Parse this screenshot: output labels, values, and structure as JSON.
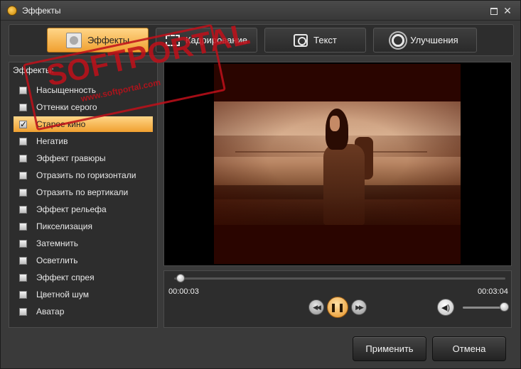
{
  "window": {
    "title": "Эффекты"
  },
  "tabs": [
    {
      "label": "Эффекты",
      "icon": "effects-icon",
      "active": true
    },
    {
      "label": "Кадрирование",
      "icon": "crop-icon",
      "active": false
    },
    {
      "label": "Текст",
      "icon": "text-icon",
      "active": false
    },
    {
      "label": "Улучшения",
      "icon": "enhance-icon",
      "active": false
    }
  ],
  "effects": {
    "label": "Эффекты:",
    "items": [
      {
        "label": "Насыщенность",
        "checked": false,
        "selected": false
      },
      {
        "label": "Оттенки серого",
        "checked": false,
        "selected": false
      },
      {
        "label": "Старое кино",
        "checked": true,
        "selected": true
      },
      {
        "label": "Негатив",
        "checked": false,
        "selected": false
      },
      {
        "label": "Эффект гравюры",
        "checked": false,
        "selected": false
      },
      {
        "label": "Отразить по горизонтали",
        "checked": false,
        "selected": false
      },
      {
        "label": "Отразить по вертикали",
        "checked": false,
        "selected": false
      },
      {
        "label": "Эффект рельефа",
        "checked": false,
        "selected": false
      },
      {
        "label": "Пикселизация",
        "checked": false,
        "selected": false
      },
      {
        "label": "Затемнить",
        "checked": false,
        "selected": false
      },
      {
        "label": "Осветлить",
        "checked": false,
        "selected": false
      },
      {
        "label": "Эффект спрея",
        "checked": false,
        "selected": false
      },
      {
        "label": "Цветной шум",
        "checked": false,
        "selected": false
      },
      {
        "label": "Аватар",
        "checked": false,
        "selected": false
      }
    ]
  },
  "player": {
    "current_time": "00:00:03",
    "duration": "00:03:04",
    "progress_fraction": 0.016,
    "volume_fraction": 1.0,
    "prev_icon": "skip-back-icon",
    "pause_icon": "pause-icon",
    "next_icon": "skip-forward-icon",
    "volume_icon": "speaker-icon"
  },
  "buttons": {
    "apply": "Применить",
    "cancel": "Отмена"
  },
  "watermark": {
    "big": "SOFTPORTAL",
    "small": "www.softportal.com"
  },
  "colors": {
    "accent": "#f0a030",
    "panel": "#2d2d2d",
    "window": "#3a3a3a"
  }
}
